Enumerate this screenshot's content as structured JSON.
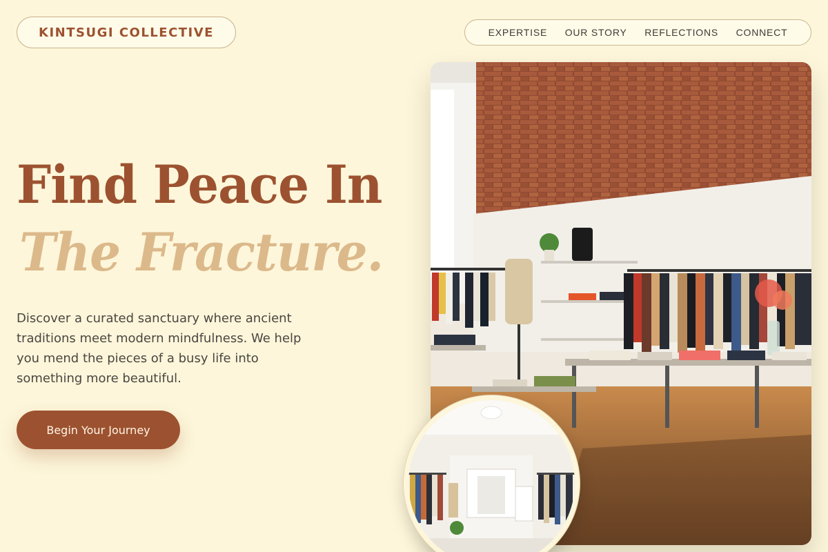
{
  "brand": {
    "name": "KINTSUGI COLLECTIVE"
  },
  "nav": {
    "items": [
      "EXPERTISE",
      "OUR STORY",
      "REFLECTIONS",
      "CONNECT"
    ]
  },
  "hero": {
    "title_line1": "Find Peace In",
    "title_line2": "The Fracture.",
    "description": "Discover a curated sanctuary where ancient traditions meet modern mindfulness. We help you mend the pieces of a busy life into something more beautiful.",
    "cta_label": "Begin Your Journey"
  },
  "colors": {
    "background": "#fdf6da",
    "accent": "#9c5230",
    "accent_light": "#dcb98b"
  },
  "images": {
    "main": "clothing-store-interior-photo",
    "round": "boutique-hallway-photo"
  }
}
